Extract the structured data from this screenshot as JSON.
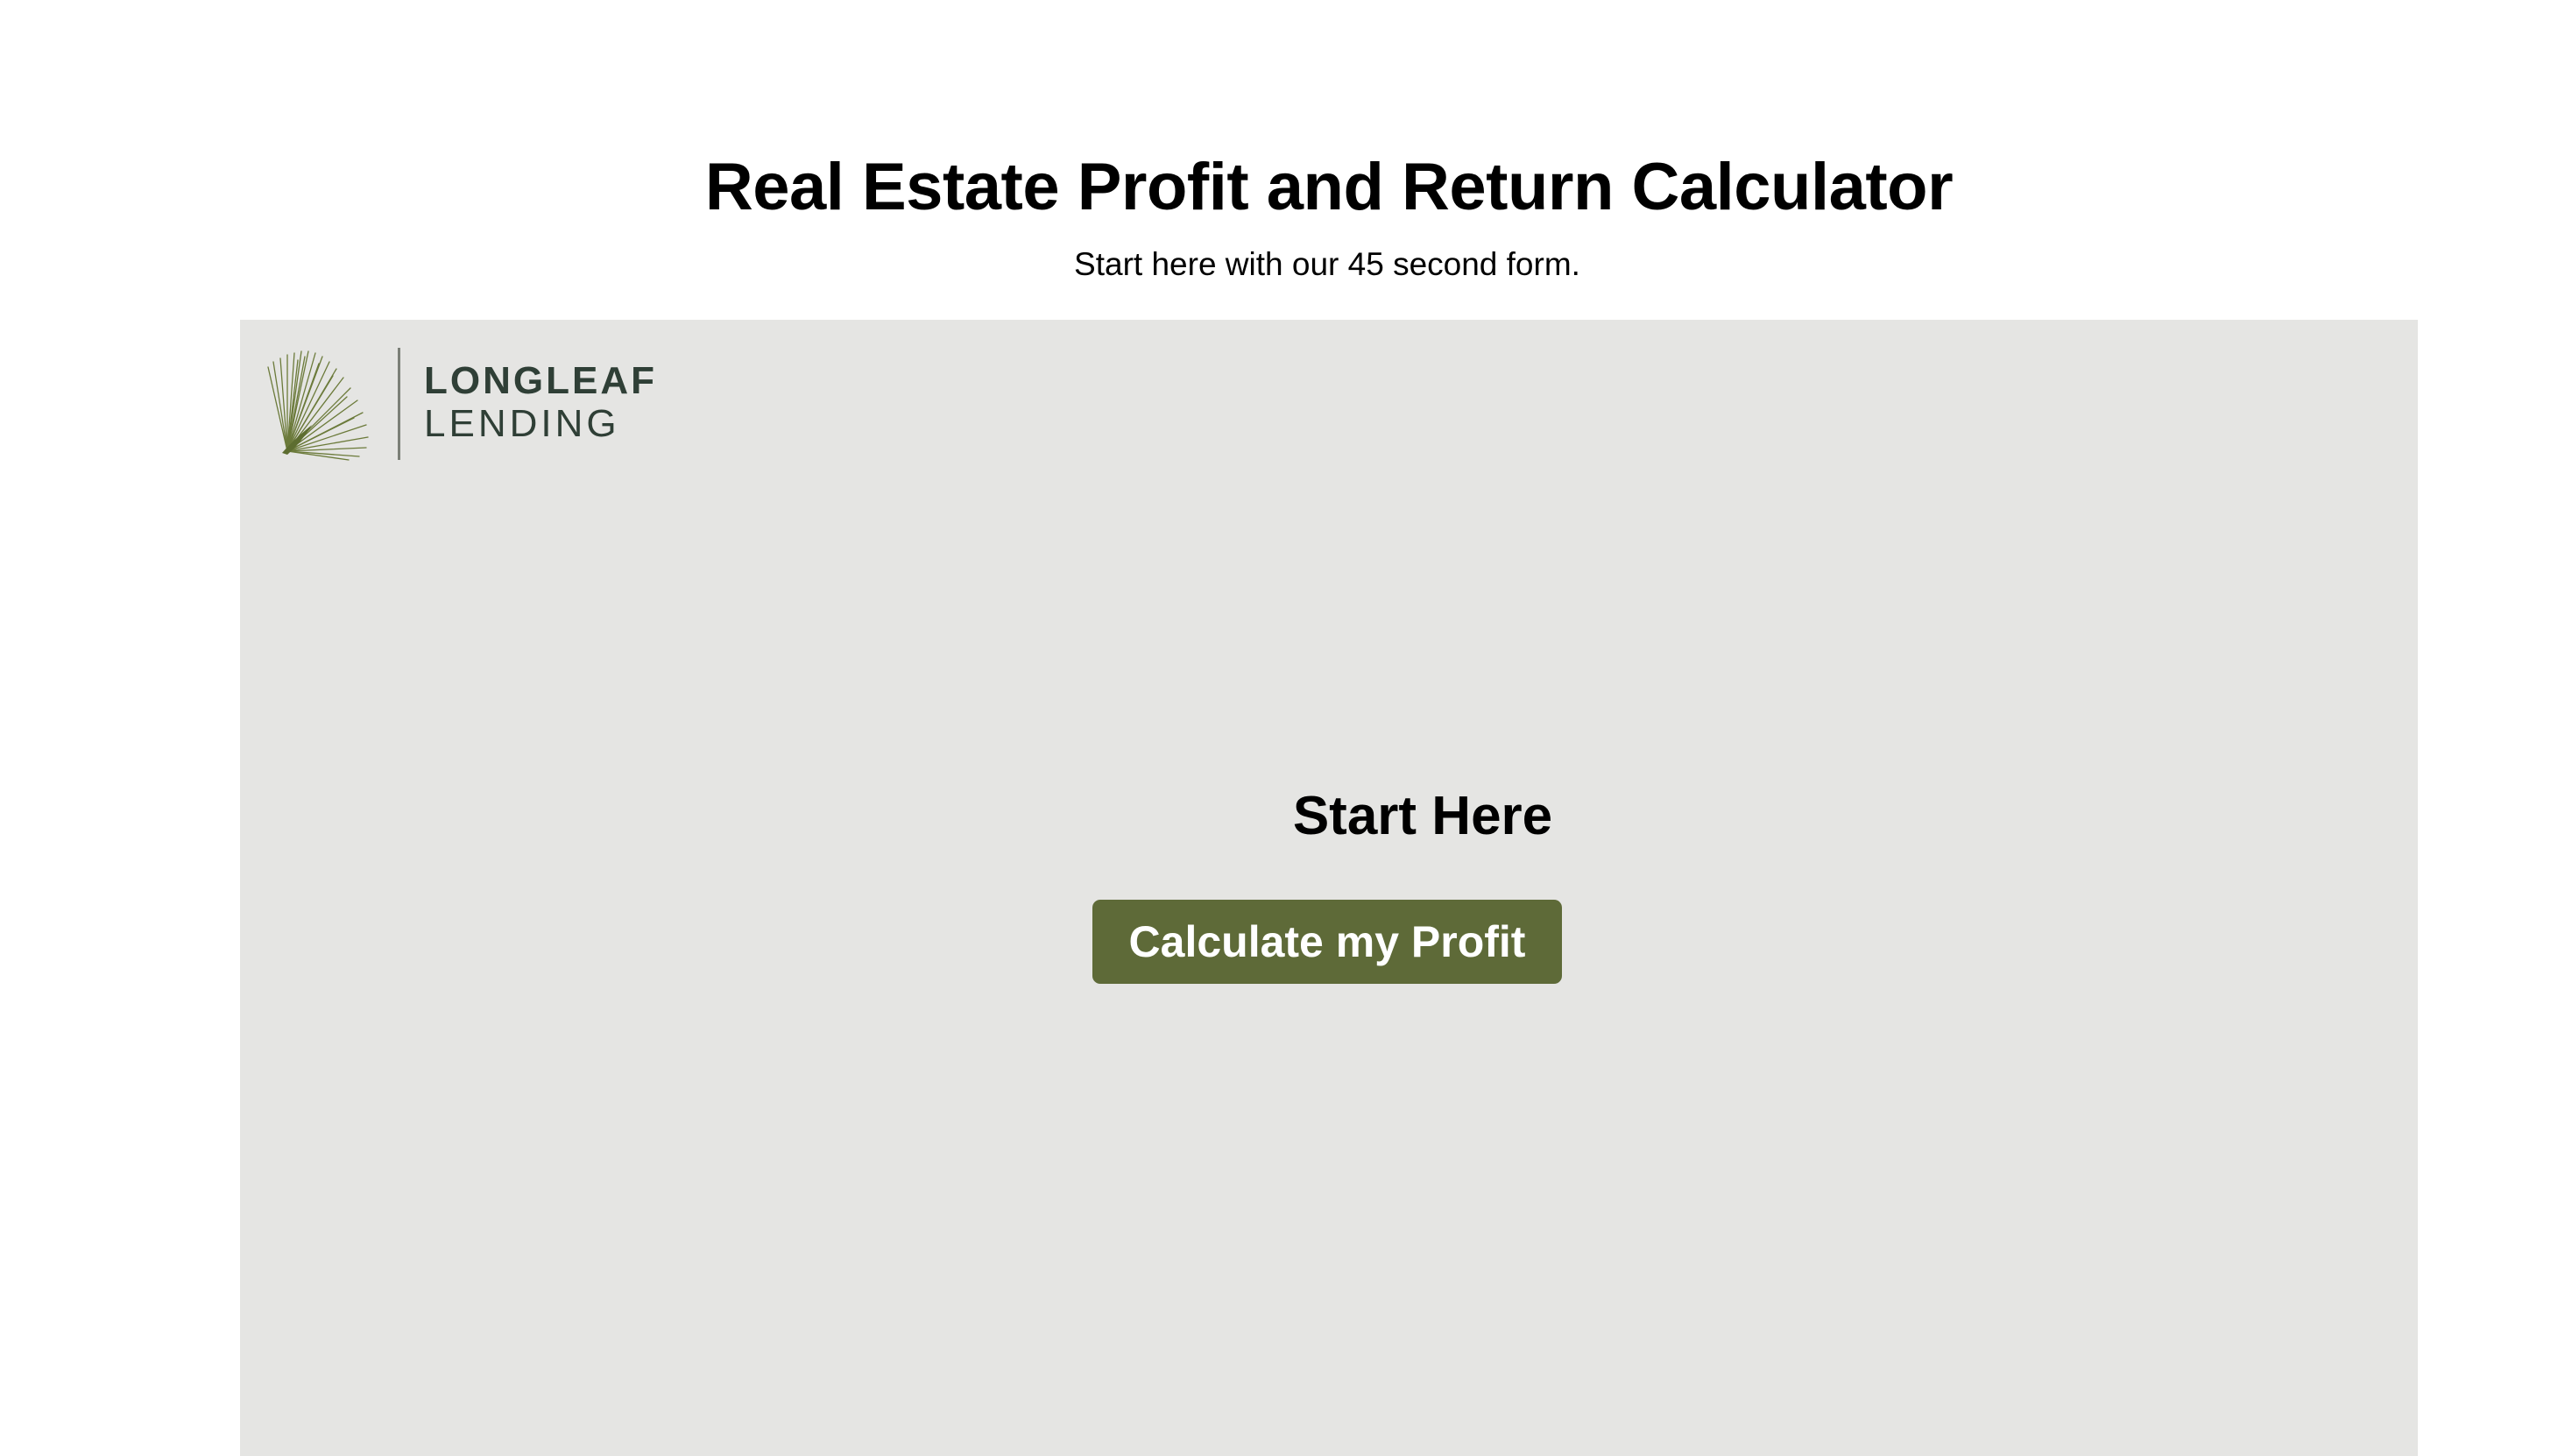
{
  "header": {
    "title": "Real Estate Profit and Return Calculator",
    "subtitle": "Start here with our 45 second form."
  },
  "form": {
    "logo": {
      "line1": "LONGLEAF",
      "line2": "LENDING",
      "icon": "pine-needle-leaf-icon"
    },
    "heading": "Start Here",
    "button_label": "Calculate my Profit"
  },
  "colors": {
    "panel_background": "#e5e5e3",
    "button_background": "#5e6a38",
    "button_text": "#ffffff",
    "logo_text": "#2f3f36"
  }
}
